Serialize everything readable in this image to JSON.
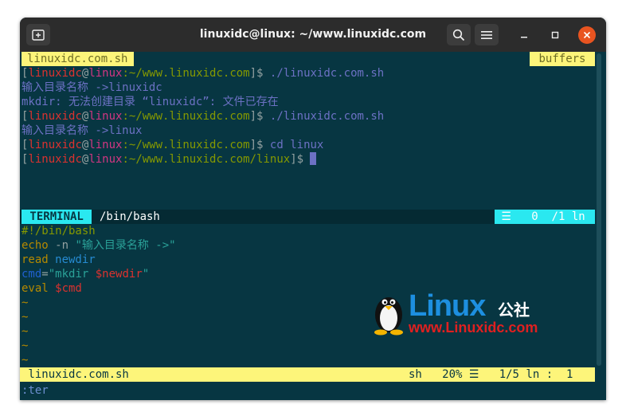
{
  "window": {
    "title": "linuxidc@linux: ~/www.linuxidc.com"
  },
  "top_bar": {
    "left_tab": "linuxidc.com.sh",
    "right_tab": "buffers"
  },
  "terminal_lines": {
    "l1": {
      "bracket_open": "[",
      "user": "linuxidc",
      "at": "@",
      "host": "linux",
      "path": ":~/www.linuxidc.com",
      "prompt": "]$ ",
      "cmd": "./linuxidc.com.sh"
    },
    "l2": "输入目录名称 ->linuxidc",
    "l3": "mkdir: 无法创建目录 “linuxidc”: 文件已存在",
    "l4": {
      "bracket_open": "[",
      "user": "linuxidc",
      "at": "@",
      "host": "linux",
      "path": ":~/www.linuxidc.com",
      "prompt": "]$ ",
      "cmd": "./linuxidc.com.sh"
    },
    "l5": "输入目录名称 ->linux",
    "l6": {
      "bracket_open": "[",
      "user": "linuxidc",
      "at": "@",
      "host": "linux",
      "path": ":~/www.linuxidc.com",
      "prompt": "]$ ",
      "cmd": "cd linux"
    },
    "l7": {
      "bracket_open": "[",
      "user": "linuxidc",
      "at": "@",
      "host": "linux",
      "path": ":~/www.linuxidc.com/linux",
      "prompt": "]$ ",
      "cmd": ""
    }
  },
  "terminal_status": {
    "mode": " TERMINAL ",
    "name": "/bin/bash",
    "right": " ☰   0  /1 ln"
  },
  "editor": {
    "l1": "#!/bin/bash",
    "l2": {
      "kw": "echo",
      "flag": " -n ",
      "str": "\"输入目录名称 ->\""
    },
    "l3": {
      "kw": "read",
      "var": " newdir"
    },
    "l4": {
      "var": "cmd",
      "eq": "=",
      "q1": "\"mkdir ",
      "sub": "$newdir",
      "q2": "\""
    },
    "l5": {
      "kw": "eval",
      "sub": " $cmd"
    },
    "tilde": "~"
  },
  "status_line": {
    "file": " linuxidc.com.sh",
    "info": "sh   20% ☰   1/5 ln :  1 "
  },
  "command_line": ":ter",
  "watermark": {
    "logo": "Linux",
    "cn": "公社",
    "url": "www.Linuxidc.com"
  },
  "colors": {
    "background": "#073642",
    "prompt_user": "#dc322f",
    "prompt_host": "#d33682",
    "prompt_path": "#859900",
    "output": "#6c71c4",
    "bar_yellow": "#fdf57a",
    "bar_cyan": "#2ae8f0"
  }
}
